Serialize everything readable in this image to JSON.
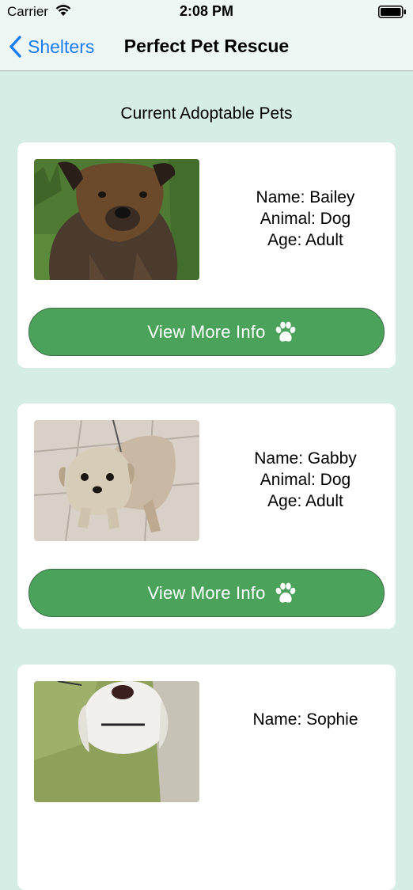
{
  "status_bar": {
    "carrier": "Carrier",
    "time": "2:08 PM"
  },
  "nav": {
    "back_label": "Shelters",
    "title": "Perfect Pet Rescue"
  },
  "section_title": "Current Adoptable Pets",
  "colors": {
    "background": "#d5ede4",
    "button": "#4ba25a",
    "link": "#1a7cf5"
  },
  "pets": [
    {
      "name": "Name: Bailey",
      "animal": "Animal: Dog",
      "age": "Age: Adult",
      "button_label": "View More Info",
      "button_icon": "paw-icon"
    },
    {
      "name": "Name: Gabby",
      "animal": "Animal: Dog",
      "age": "Age: Adult",
      "button_label": "View More Info",
      "button_icon": "paw-icon"
    },
    {
      "name": "Name: Sophie",
      "animal": "",
      "age": "",
      "button_label": "",
      "button_icon": "paw-icon"
    }
  ]
}
